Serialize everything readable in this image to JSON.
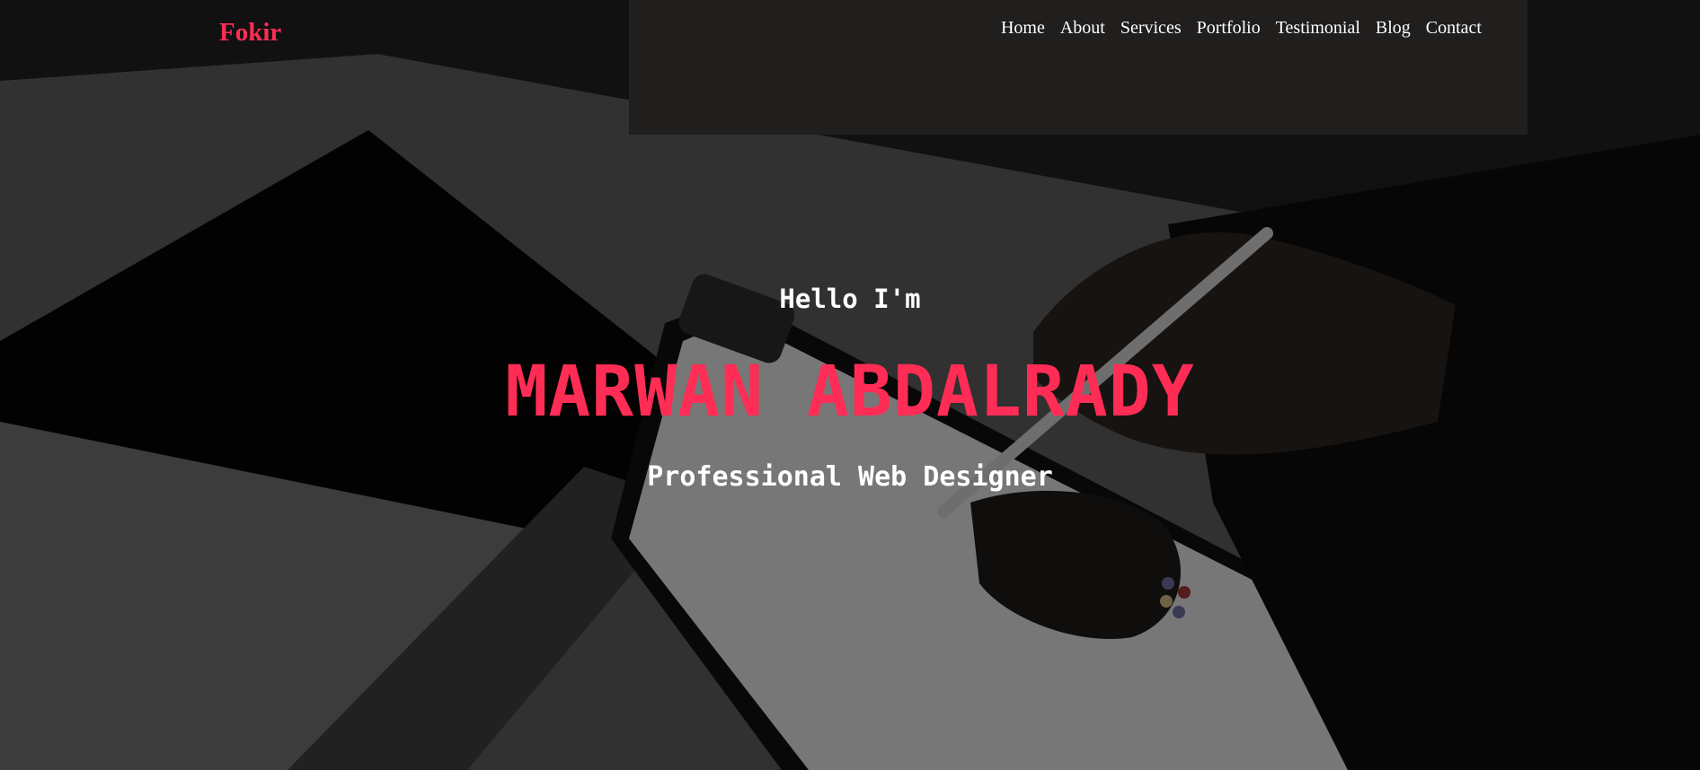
{
  "brand": {
    "logo": "Fokir",
    "accent_color": "#ff2d55"
  },
  "nav": {
    "items": [
      {
        "label": "Home"
      },
      {
        "label": "About"
      },
      {
        "label": "Services"
      },
      {
        "label": "Portfolio"
      },
      {
        "label": "Testimonial"
      },
      {
        "label": "Blog"
      },
      {
        "label": "Contact"
      }
    ]
  },
  "hero": {
    "greeting": "Hello I'm",
    "name": "MARWAN ABDALRADY",
    "role": "Professional Web Designer"
  }
}
